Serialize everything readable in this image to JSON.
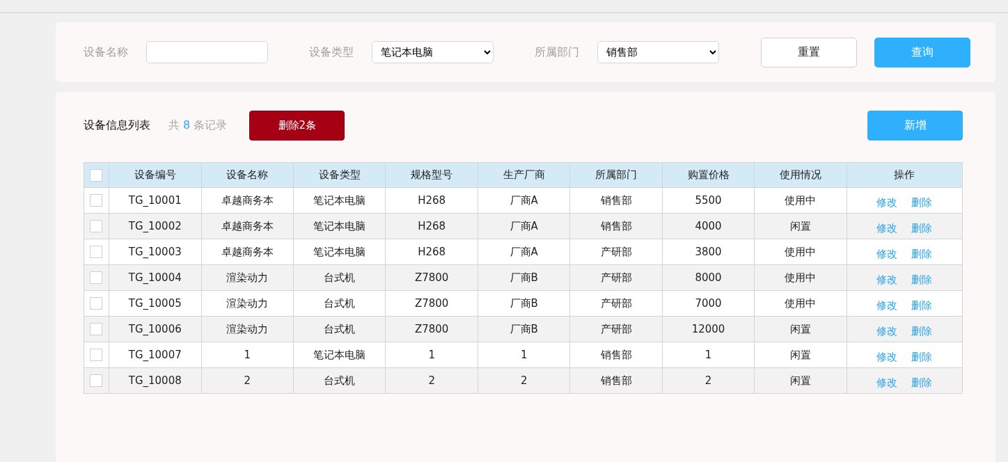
{
  "filters": [
    {
      "kind": "text",
      "label": "设备名称"
    },
    {
      "kind": "select",
      "label": "设备类型",
      "value": "笔记本电脑"
    },
    {
      "kind": "select",
      "label": "所属部门",
      "value": "销售部"
    }
  ],
  "filter_buttons": [
    {
      "label": "重置",
      "kind": "plain"
    },
    {
      "label": "查询",
      "kind": "primary"
    }
  ],
  "list": {
    "title": "设备信息列表",
    "count_prefix": "共",
    "count": "8",
    "count_suffix": "条记录",
    "delete_button": "删除2条",
    "add_button": "新增"
  },
  "table": {
    "header_checked": false,
    "columns": [
      "设备编号",
      "设备名称",
      "设备类型",
      "规格型号",
      "生产厂商",
      "所属部门",
      "购置价格",
      "使用情况",
      "操作"
    ],
    "rows": [
      {
        "checked": false,
        "cells": [
          "TG_10001",
          "卓越商务本",
          "笔记本电脑",
          "H268",
          "厂商A",
          "销售部",
          "5500",
          "使用中"
        ],
        "actions": [
          "修改",
          "删除"
        ]
      },
      {
        "checked": false,
        "cells": [
          "TG_10002",
          "卓越商务本",
          "笔记本电脑",
          "H268",
          "厂商A",
          "销售部",
          "4000",
          "闲置"
        ],
        "actions": [
          "修改",
          "删除"
        ]
      },
      {
        "checked": false,
        "cells": [
          "TG_10003",
          "卓越商务本",
          "笔记本电脑",
          "H268",
          "厂商A",
          "产研部",
          "3800",
          "使用中"
        ],
        "actions": [
          "修改",
          "删除"
        ]
      },
      {
        "checked": false,
        "cells": [
          "TG_10004",
          "渲染动力",
          "台式机",
          "Z7800",
          "厂商B",
          "产研部",
          "8000",
          "使用中"
        ],
        "actions": [
          "修改",
          "删除"
        ]
      },
      {
        "checked": false,
        "cells": [
          "TG_10005",
          "渲染动力",
          "台式机",
          "Z7800",
          "厂商B",
          "产研部",
          "7000",
          "使用中"
        ],
        "actions": [
          "修改",
          "删除"
        ]
      },
      {
        "checked": false,
        "cells": [
          "TG_10006",
          "渲染动力",
          "台式机",
          "Z7800",
          "厂商B",
          "产研部",
          "12000",
          "闲置"
        ],
        "actions": [
          "修改",
          "删除"
        ]
      },
      {
        "checked": false,
        "cells": [
          "TG_10007",
          "1",
          "笔记本电脑",
          "1",
          "1",
          "销售部",
          "1",
          "闲置"
        ],
        "actions": [
          "修改",
          "删除"
        ]
      },
      {
        "checked": false,
        "cells": [
          "TG_10008",
          "2",
          "台式机",
          "2",
          "2",
          "销售部",
          "2",
          "闲置"
        ],
        "actions": [
          "修改",
          "删除"
        ]
      }
    ]
  }
}
